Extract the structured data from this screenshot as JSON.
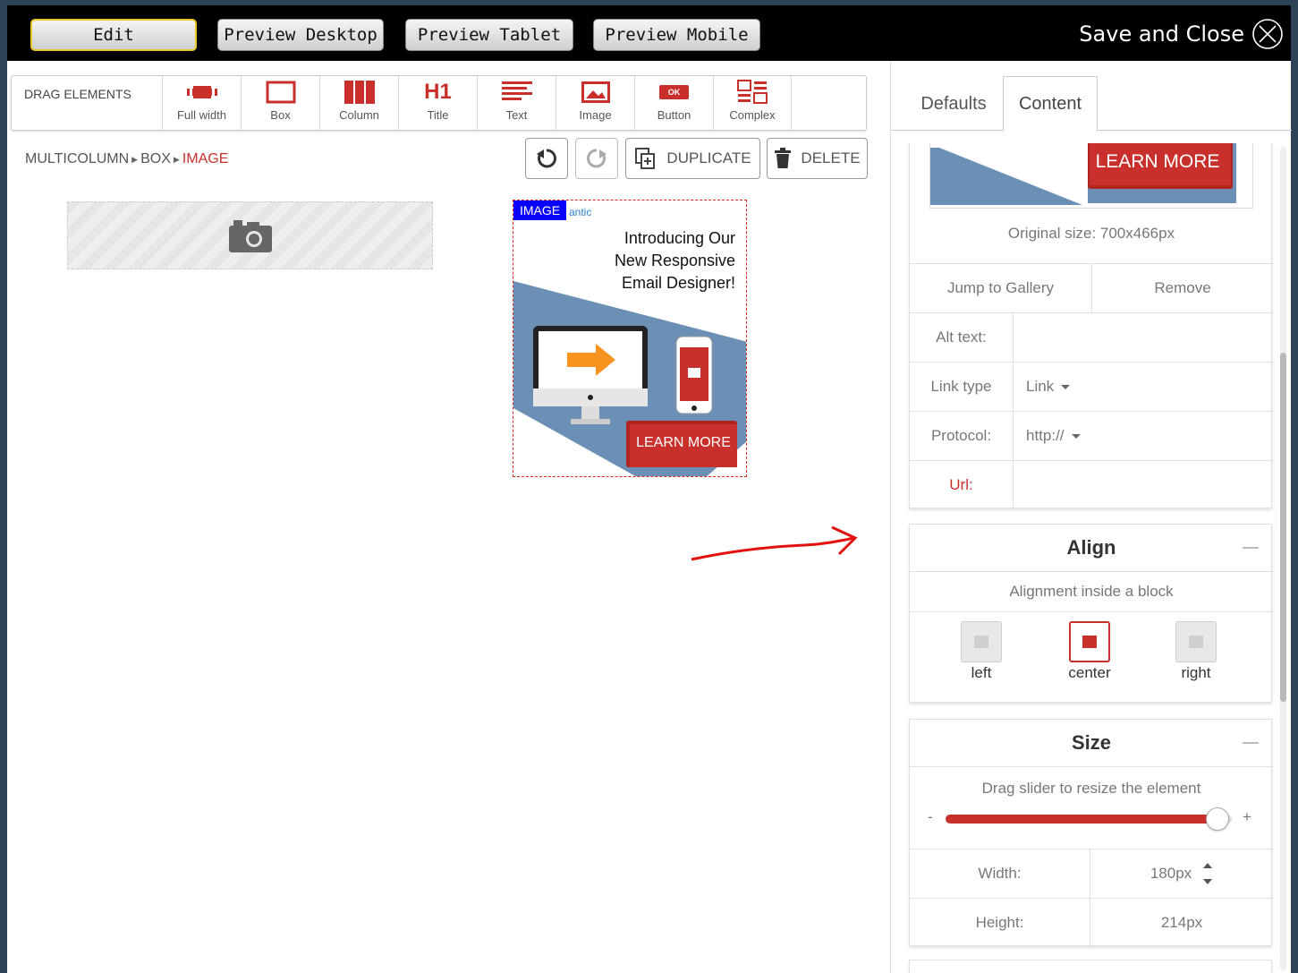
{
  "topbar": {
    "modes": [
      {
        "label": "Edit",
        "active": true
      },
      {
        "label": "Preview Desktop",
        "active": false
      },
      {
        "label": "Preview Tablet",
        "active": false
      },
      {
        "label": "Preview Mobile",
        "active": false
      }
    ],
    "save_close_label": "Save and Close"
  },
  "drag_bar": {
    "title": "DRAG ELEMENTS",
    "items": [
      {
        "label": "Full width",
        "icon": "full-width-icon"
      },
      {
        "label": "Box",
        "icon": "box-icon"
      },
      {
        "label": "Column",
        "icon": "column-icon"
      },
      {
        "label": "Title",
        "icon": "title-icon",
        "glyph": "H1"
      },
      {
        "label": "Text",
        "icon": "text-icon"
      },
      {
        "label": "Image",
        "icon": "image-icon"
      },
      {
        "label": "Button",
        "icon": "button-icon",
        "glyph": "OK"
      },
      {
        "label": "Complex",
        "icon": "complex-icon"
      }
    ]
  },
  "breadcrumb": {
    "items": [
      "MULTICOLUMN",
      "BOX"
    ],
    "current": "IMAGE"
  },
  "toolbar": {
    "duplicate_label": "DUPLICATE",
    "delete_label": "DELETE"
  },
  "canvas": {
    "image_badge": "IMAGE",
    "image_brand": "antic",
    "image_heading_lines": [
      "Introducing Our",
      "New Responsive",
      "Email Designer!"
    ],
    "image_button_text": "LEARN MORE"
  },
  "panel": {
    "tabs": [
      {
        "label": "Defaults",
        "active": false
      },
      {
        "label": "Content",
        "active": true
      }
    ],
    "preview_button_text": "LEARN MORE",
    "original_size": "Original size: 700x466px",
    "jump_to_gallery": "Jump to Gallery",
    "remove": "Remove",
    "alt_text_label": "Alt text:",
    "alt_text_value": "",
    "link_type_label": "Link type",
    "link_type_value": "Link",
    "protocol_label": "Protocol:",
    "protocol_value": "http://",
    "url_label": "Url:",
    "url_value": "",
    "align": {
      "title": "Align",
      "subtitle": "Alignment inside a block",
      "options": [
        {
          "label": "left",
          "active": false
        },
        {
          "label": "center",
          "active": true
        },
        {
          "label": "right",
          "active": false
        }
      ]
    },
    "size": {
      "title": "Size",
      "subtitle": "Drag slider to resize the element",
      "minus": "-",
      "plus": "+",
      "slider_fraction": 0.95,
      "width_label": "Width:",
      "width_value": "180px",
      "height_label": "Height:",
      "height_value": "214px"
    }
  },
  "colors": {
    "accent_red": "#c9302c",
    "badge_blue": "#0a00ff",
    "topbar_black": "#000000",
    "active_outline": "#e8c62a"
  }
}
